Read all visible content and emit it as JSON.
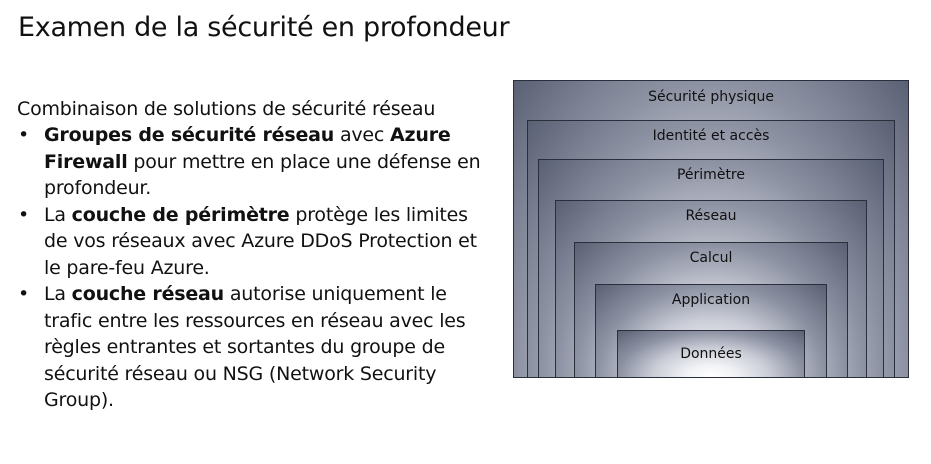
{
  "slide": {
    "title": "Examen de la sécurité en profondeur",
    "subheading": "Combinaison de solutions de sécurité réseau"
  },
  "bullets": [
    {
      "parts": [
        {
          "text": "Groupes de sécurité réseau",
          "bold": true
        },
        {
          "text": " avec ",
          "bold": false
        },
        {
          "text": "Azure Firewall",
          "bold": true
        },
        {
          "text": " pour mettre en place une défense en profondeur.",
          "bold": false
        }
      ]
    },
    {
      "parts": [
        {
          "text": "La ",
          "bold": false
        },
        {
          "text": "couche de périmètre",
          "bold": true
        },
        {
          "text": " protège les limites de vos réseaux avec Azure DDoS Protection et le pare-feu Azure.",
          "bold": false
        }
      ]
    },
    {
      "parts": [
        {
          "text": "La ",
          "bold": false
        },
        {
          "text": "couche réseau",
          "bold": true
        },
        {
          "text": " autorise uniquement le trafic entre les ressources en réseau avec les règles entrantes et sortantes du groupe de sécurité réseau ou NSG (Network Security Group).",
          "bold": false
        }
      ]
    }
  ],
  "diagram": {
    "layers": [
      "Sécurité physique",
      "Identité et accès",
      "Périmètre",
      "Réseau",
      "Calcul",
      "Application",
      "Données"
    ]
  }
}
